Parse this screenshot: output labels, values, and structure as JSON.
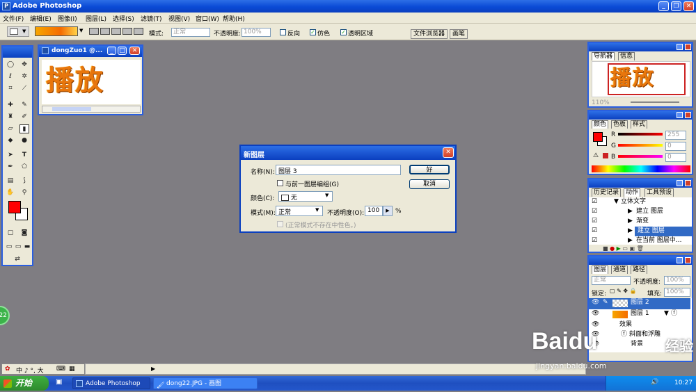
{
  "app": {
    "title": "Adobe Photoshop"
  },
  "menu": [
    "文件(F)",
    "编辑(E)",
    "图像(I)",
    "图层(L)",
    "选择(S)",
    "滤镜(T)",
    "视图(V)",
    "窗口(W)",
    "帮助(H)"
  ],
  "options": {
    "mode_label": "模式:",
    "mode_value": "正常",
    "opacity_label": "不透明度:",
    "opacity_value": "100%",
    "reverse_label": "反向",
    "dither_label": "仿色",
    "transparency_label": "透明区域",
    "tab_file_browser": "文件浏览器",
    "tab_brushes": "画笔",
    "gradient_colors": [
      "#f7a600",
      "#f56c00",
      "#ffd34a"
    ]
  },
  "document": {
    "title": "dongZuo1 @...",
    "text": "播放"
  },
  "dialog": {
    "title": "新图层",
    "name_label": "名称(N):",
    "name_value": "图层 3",
    "ok": "好",
    "cancel": "取消",
    "group_label": "与前一图层编组(G)",
    "color_label": "颜色(C):",
    "color_value": "无",
    "mode_label": "模式(M):",
    "mode_value": "正常",
    "opacity_label": "不透明度(O):",
    "opacity_value": "100",
    "opacity_unit": "%",
    "neutral_label": "(正常模式不存在中性色。)"
  },
  "navigator": {
    "tabs": [
      "导航器",
      "信息"
    ],
    "zoom": "110%",
    "preview_text": "播放"
  },
  "color_panel": {
    "tabs": [
      "颜色",
      "色板",
      "样式"
    ],
    "r_label": "R",
    "g_label": "G",
    "b_label": "B",
    "r": "255",
    "g": "0",
    "b": "0",
    "foreground": "#ff0000"
  },
  "history": {
    "tabs": [
      "历史记录",
      "动作",
      "工具预设"
    ],
    "items": [
      "立体文字",
      "建立 图层",
      "渐变",
      "建立 图层",
      "在当前 图层中..."
    ]
  },
  "layers": {
    "tabs": [
      "图层",
      "通道",
      "路径"
    ],
    "mode": "正常",
    "opacity_label": "不透明度:",
    "opacity": "100%",
    "lock_label": "锁定:",
    "fill_label": "填充:",
    "fill": "100%",
    "items": [
      "图层 2",
      "图层 1",
      "效果",
      "斜面和浮雕",
      "背景"
    ]
  },
  "ime": {
    "text": "中 ♪ °, 大"
  },
  "taskbar": {
    "start": "开始",
    "tasks": [
      "Adobe Photoshop",
      "dong22.JPG - 画图"
    ],
    "time": "10:27"
  },
  "side_badge": "22",
  "watermark": {
    "brand": "Baidu",
    "sub": "经验",
    "url": "jingyan.baidu.com"
  }
}
